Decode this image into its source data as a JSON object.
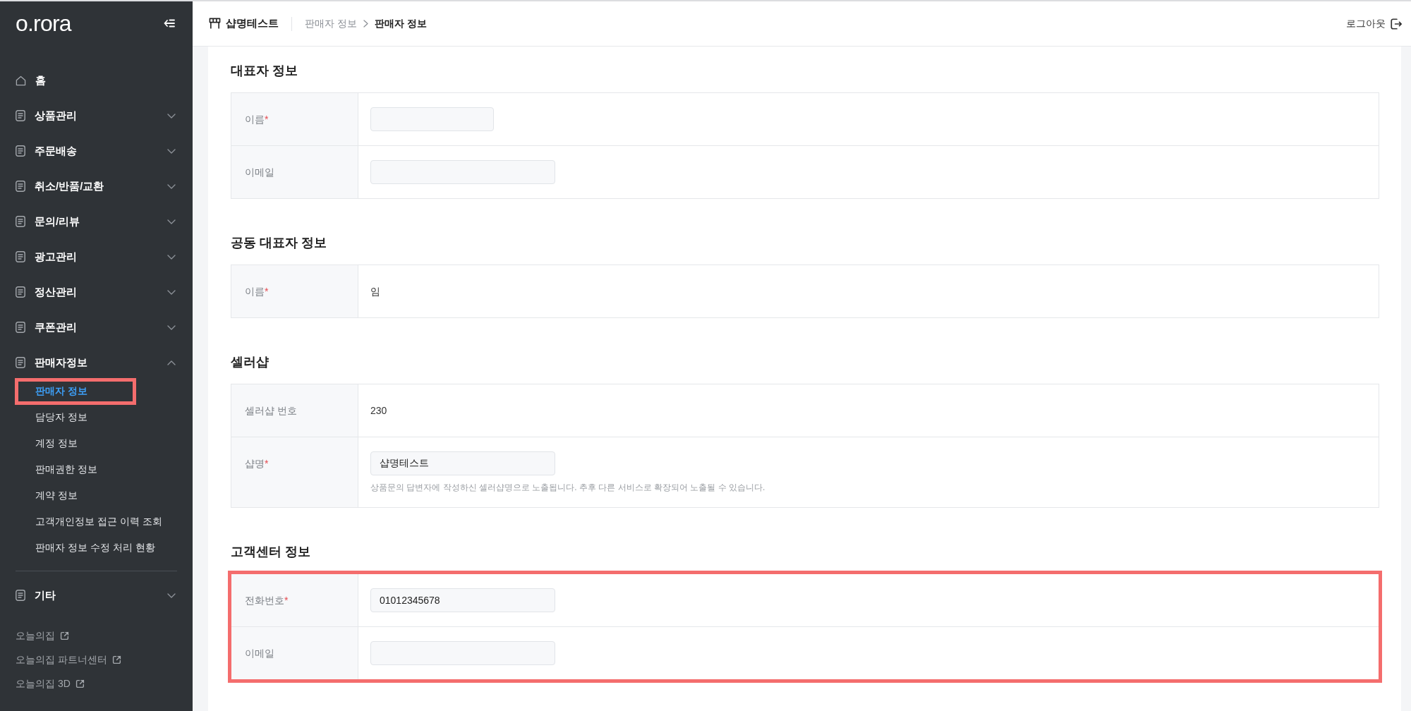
{
  "sidebar": {
    "logo": "o.rora",
    "menu": [
      {
        "label": "홈",
        "kind": "home"
      },
      {
        "label": "상품관리",
        "kind": "group",
        "expanded": false
      },
      {
        "label": "주문배송",
        "kind": "group",
        "expanded": false
      },
      {
        "label": "취소/반품/교환",
        "kind": "group",
        "expanded": false
      },
      {
        "label": "문의/리뷰",
        "kind": "group",
        "expanded": false
      },
      {
        "label": "광고관리",
        "kind": "group",
        "expanded": false
      },
      {
        "label": "정산관리",
        "kind": "group",
        "expanded": false
      },
      {
        "label": "쿠폰관리",
        "kind": "group",
        "expanded": false
      },
      {
        "label": "판매자정보",
        "kind": "group",
        "expanded": true,
        "children": [
          {
            "label": "판매자 정보",
            "selected": true,
            "highlighted": true
          },
          {
            "label": "담당자 정보",
            "selected": false,
            "highlighted": false
          },
          {
            "label": "계정 정보",
            "selected": false,
            "highlighted": false
          },
          {
            "label": "판매권한 정보",
            "selected": false,
            "highlighted": false
          },
          {
            "label": "계약 정보",
            "selected": false,
            "highlighted": false
          },
          {
            "label": "고객개인정보 접근 이력 조회",
            "selected": false,
            "highlighted": false
          },
          {
            "label": "판매자 정보 수정 처리 현황",
            "selected": false,
            "highlighted": false
          }
        ]
      }
    ],
    "menu_extra": [
      {
        "label": "기타",
        "kind": "group",
        "expanded": false
      }
    ],
    "external_links": [
      {
        "label": "오늘의집"
      },
      {
        "label": "오늘의집 파트너센터"
      },
      {
        "label": "오늘의집 3D"
      }
    ]
  },
  "header": {
    "shop_name": "샵명테스트",
    "breadcrumb": [
      {
        "label": "판매자 정보",
        "current": false
      },
      {
        "label": "판매자 정보",
        "current": true
      }
    ],
    "logout": "로그아웃"
  },
  "sections": [
    {
      "title": "대표자 정보",
      "highlighted": false,
      "rows": [
        {
          "label": "이름",
          "required_mark": "*",
          "kind": "narrowfield"
        },
        {
          "label": "이메일",
          "kind": "field"
        }
      ]
    },
    {
      "title": "공동 대표자 정보",
      "highlighted": false,
      "rows": [
        {
          "label": "이름",
          "required_mark": "*",
          "kind": "text",
          "value": "임"
        }
      ]
    },
    {
      "title": "셀러샵",
      "highlighted": false,
      "rows": [
        {
          "label": "셀러샵 번호",
          "kind": "text",
          "value": "230"
        },
        {
          "label": "샵명",
          "required_mark": "*",
          "kind": "field",
          "value": "샵명테스트",
          "hint": "상품문의 답변자에 작성하신 셀러샵명으로 노출됩니다. 추후 다른 서비스로 확장되어 노출될 수 있습니다."
        }
      ]
    },
    {
      "title": "고객센터 정보",
      "highlighted": true,
      "rows": [
        {
          "label": "전화번호",
          "required_mark": "*",
          "kind": "field",
          "value": "01012345678"
        },
        {
          "label": "이메일",
          "kind": "field"
        }
      ]
    }
  ]
}
